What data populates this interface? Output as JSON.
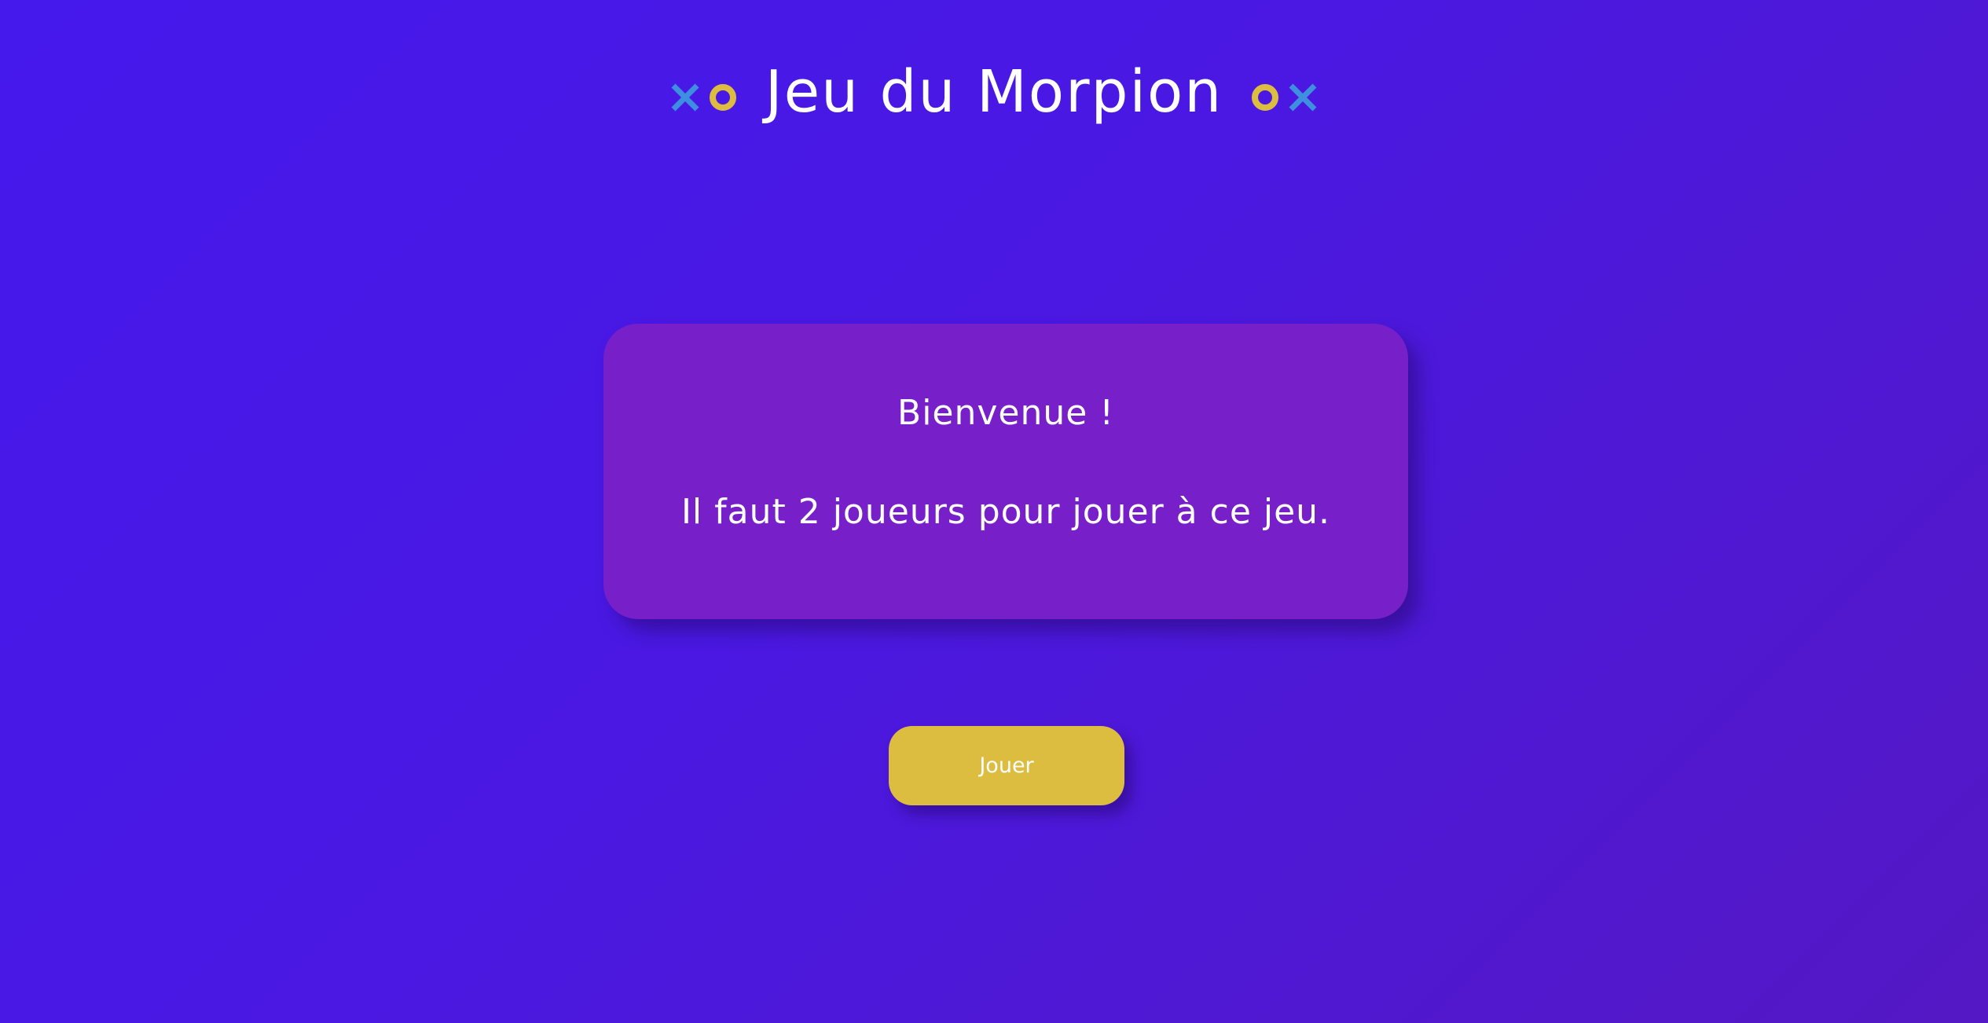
{
  "header": {
    "title": "Jeu du Morpion",
    "left_icons": [
      "cross-icon",
      "circle-icon"
    ],
    "right_icons": [
      "circle-icon",
      "cross-icon"
    ]
  },
  "welcome_card": {
    "title": "Bienvenue !",
    "message": "Il faut 2 joueurs pour jouer à ce jeu."
  },
  "play_button": {
    "label": "Jouer"
  },
  "colors": {
    "background_start": "#4518ec",
    "background_end": "#5418c4",
    "card": "#771fc8",
    "button": "#dcbd40",
    "cross": "#3f8fe0",
    "circle": "#dcbd40",
    "text": "#ffffff"
  }
}
